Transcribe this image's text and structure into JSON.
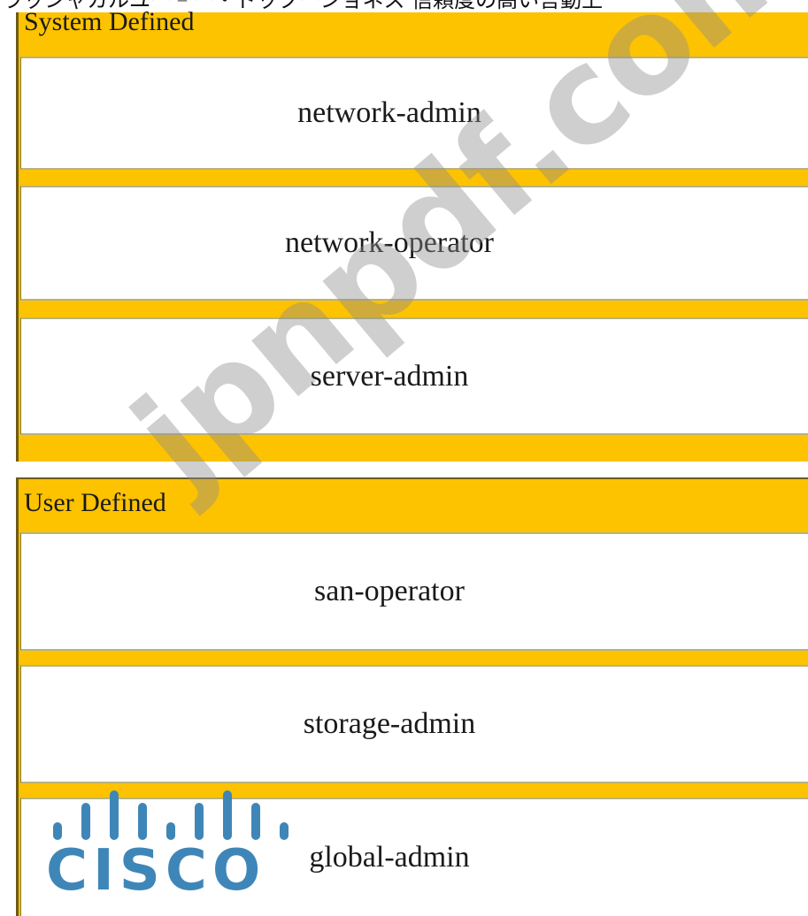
{
  "top_text": "ラッシャカルユー゠ー・ドックーショネス 信頼度の高い言動上",
  "sections": [
    {
      "header": "System Defined",
      "roles": [
        "network-admin",
        "network-operator",
        "server-admin"
      ]
    },
    {
      "header": "User Defined",
      "roles": [
        "san-operator",
        "storage-admin",
        "global-admin"
      ]
    }
  ],
  "watermark": "jpnpdf.com",
  "logo": {
    "text": "CISCO",
    "color": "#3f86b8"
  },
  "colors": {
    "panel": "#fdc200",
    "box": "#ffffff",
    "text": "#1a1a1a"
  }
}
